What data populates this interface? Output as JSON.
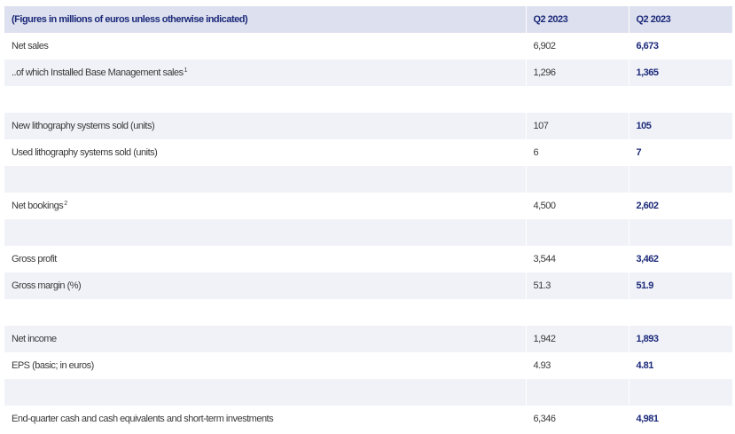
{
  "header": {
    "label": "(Figures in millions of euros unless otherwise indicated)",
    "col_prev": "Q2 2023",
    "col_curr": "Q2 2023"
  },
  "rows": [
    {
      "label": "Net sales",
      "sup": "",
      "prev": "6,902",
      "curr": "6,673"
    },
    {
      "label": "..of which Installed Base Management sales",
      "sup": "1",
      "prev": "1,296",
      "curr": "1,365"
    },
    {
      "label": "",
      "sup": "",
      "prev": "",
      "curr": ""
    },
    {
      "label": "New lithography systems sold (units)",
      "sup": "",
      "prev": "107",
      "curr": "105"
    },
    {
      "label": "Used lithography systems sold (units)",
      "sup": "",
      "prev": "6",
      "curr": "7"
    },
    {
      "label": "",
      "sup": "",
      "prev": "",
      "curr": ""
    },
    {
      "label": "Net bookings",
      "sup": "2",
      "prev": "4,500",
      "curr": "2,602"
    },
    {
      "label": "",
      "sup": "",
      "prev": "",
      "curr": ""
    },
    {
      "label": "Gross profit",
      "sup": "",
      "prev": "3,544",
      "curr": "3,462"
    },
    {
      "label": "Gross margin (%)",
      "sup": "",
      "prev": "51.3",
      "curr": "51.9"
    },
    {
      "label": "",
      "sup": "",
      "prev": "",
      "curr": ""
    },
    {
      "label": "Net income",
      "sup": "",
      "prev": "1,942",
      "curr": "1,893"
    },
    {
      "label": "EPS (basic; in euros)",
      "sup": "",
      "prev": "4.93",
      "curr": "4.81"
    },
    {
      "label": "",
      "sup": "",
      "prev": "",
      "curr": ""
    },
    {
      "label": "End-quarter cash and cash equivalents and short-term investments",
      "sup": "",
      "prev": "6,346",
      "curr": "4,981"
    }
  ]
}
